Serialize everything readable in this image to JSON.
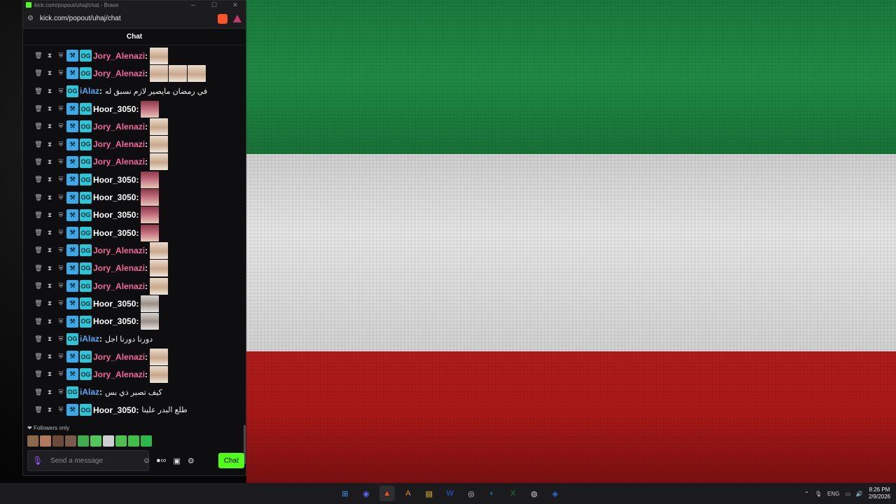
{
  "window": {
    "title": "kick.com/popout/uhaj/chat - Brave",
    "url": "kick.com/popout/uhaj/chat",
    "chat_header": "Chat"
  },
  "messages": [
    {
      "user": "Jory_Alenazi",
      "color": "pink",
      "badges": [
        "hammer",
        "og"
      ],
      "emotes": [
        "kid"
      ],
      "text": ""
    },
    {
      "user": "Jory_Alenazi",
      "color": "pink",
      "badges": [
        "hammer",
        "og"
      ],
      "emotes": [
        "kid",
        "kid",
        "kid"
      ],
      "text": ""
    },
    {
      "user": "iAlaz",
      "color": "blue",
      "badges": [
        "og"
      ],
      "emotes": [],
      "text": "في رمضان مايصير لازم نسبق له"
    },
    {
      "user": "Hoor_3050",
      "color": "white",
      "badges": [
        "hammer",
        "og"
      ],
      "emotes": [
        "girl"
      ],
      "text": ""
    },
    {
      "user": "Jory_Alenazi",
      "color": "pink",
      "badges": [
        "hammer",
        "og"
      ],
      "emotes": [
        "kid"
      ],
      "text": ""
    },
    {
      "user": "Jory_Alenazi",
      "color": "pink",
      "badges": [
        "hammer",
        "og"
      ],
      "emotes": [
        "kid"
      ],
      "text": ""
    },
    {
      "user": "Jory_Alenazi",
      "color": "pink",
      "badges": [
        "hammer",
        "og"
      ],
      "emotes": [
        "kid"
      ],
      "text": ""
    },
    {
      "user": "Hoor_3050",
      "color": "white",
      "badges": [
        "hammer",
        "og"
      ],
      "emotes": [
        "girl"
      ],
      "text": ""
    },
    {
      "user": "Hoor_3050",
      "color": "white",
      "badges": [
        "hammer",
        "og"
      ],
      "emotes": [
        "girl"
      ],
      "text": ""
    },
    {
      "user": "Hoor_3050",
      "color": "white",
      "badges": [
        "hammer",
        "og"
      ],
      "emotes": [
        "girl"
      ],
      "text": ""
    },
    {
      "user": "Hoor_3050",
      "color": "white",
      "badges": [
        "hammer",
        "og"
      ],
      "emotes": [
        "girl"
      ],
      "text": ""
    },
    {
      "user": "Jory_Alenazi",
      "color": "pink",
      "badges": [
        "hammer",
        "og"
      ],
      "emotes": [
        "kid"
      ],
      "text": ""
    },
    {
      "user": "Jory_Alenazi",
      "color": "pink",
      "badges": [
        "hammer",
        "og"
      ],
      "emotes": [
        "kid"
      ],
      "text": ""
    },
    {
      "user": "Jory_Alenazi",
      "color": "pink",
      "badges": [
        "hammer",
        "og"
      ],
      "emotes": [
        "kid"
      ],
      "text": ""
    },
    {
      "user": "Hoor_3050",
      "color": "white",
      "badges": [
        "hammer",
        "og"
      ],
      "emotes": [
        "gray"
      ],
      "text": ""
    },
    {
      "user": "Hoor_3050",
      "color": "white",
      "badges": [
        "hammer",
        "og"
      ],
      "emotes": [
        "gray"
      ],
      "text": ""
    },
    {
      "user": "iAlaz",
      "color": "blue",
      "badges": [
        "og"
      ],
      "emotes": [],
      "text": "دورنا دورنا اجل"
    },
    {
      "user": "Jory_Alenazi",
      "color": "pink",
      "badges": [
        "hammer",
        "og"
      ],
      "emotes": [
        "kid"
      ],
      "text": ""
    },
    {
      "user": "Jory_Alenazi",
      "color": "pink",
      "badges": [
        "hammer",
        "og"
      ],
      "emotes": [
        "kid"
      ],
      "text": ""
    },
    {
      "user": "iAlaz",
      "color": "blue",
      "badges": [
        "og"
      ],
      "emotes": [],
      "text": "كيف تصير ذي بس"
    },
    {
      "user": "Hoor_3050",
      "color": "white",
      "badges": [
        "hammer",
        "og"
      ],
      "emotes": [],
      "text": "طلع البدر علينا"
    }
  ],
  "footer": {
    "followers_only": "Followers only",
    "input_placeholder": "Send a message",
    "chat_button": "Chat"
  },
  "quick_emote_colors": [
    "#8a6a4a",
    "#b07a60",
    "#6b4a3a",
    "#7a5a4a",
    "#3fae4a",
    "#53c55a",
    "#cfcfcf",
    "#4fbf50",
    "#3fbf4a",
    "#2fb84a"
  ],
  "colors": {
    "accent": "#53fc18",
    "pink_name": "#f2689a",
    "blue_name": "#5aa5f2",
    "flag_green": "#1f8a45",
    "flag_white": "#e0e0e0",
    "flag_red": "#b01c1c"
  },
  "taskbar": {
    "apps": [
      "windows-start",
      "discord",
      "brave",
      "app-a",
      "file-explorer",
      "word-app",
      "obs",
      "steam",
      "excel",
      "chrome-like",
      "browser-blue"
    ],
    "language": "ENG",
    "time": "8:26 PM",
    "date": "2/9/2026"
  }
}
